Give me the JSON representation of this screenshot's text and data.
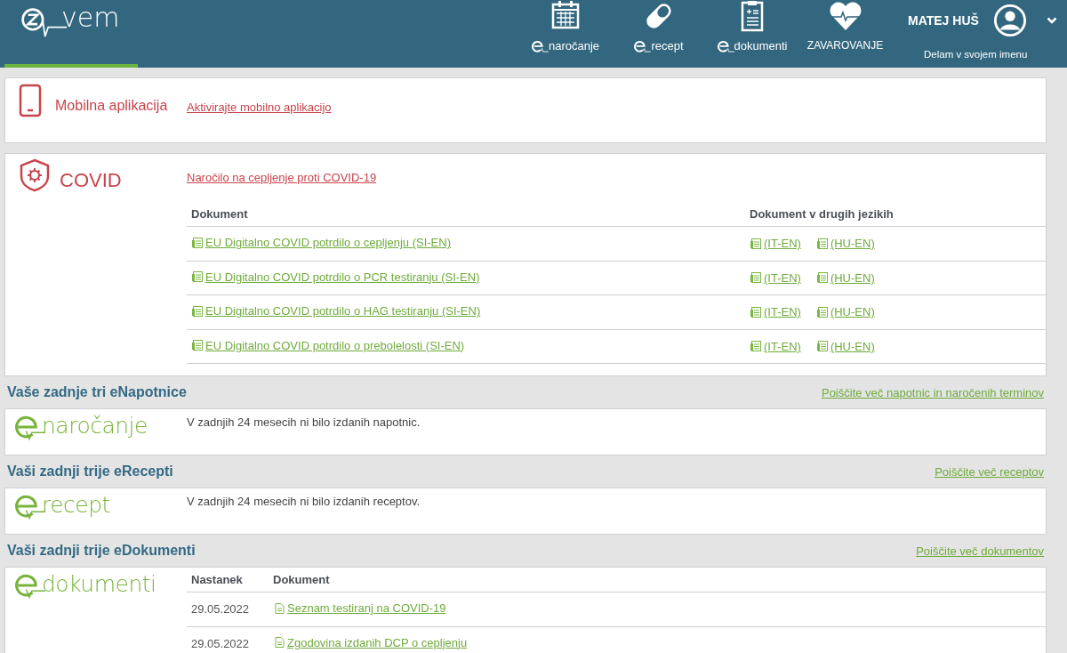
{
  "header": {
    "logo_text": "vem",
    "logo_selected": true,
    "nav": [
      {
        "label": "naročanje",
        "kind": "e-service"
      },
      {
        "label": "recept",
        "kind": "e-service"
      },
      {
        "label": "dokumenti",
        "kind": "e-service"
      },
      {
        "label": "ZAVAROVANJE",
        "kind": "plain"
      }
    ],
    "user": {
      "name": "MATEJ HUŠ",
      "subtitle": "Delam v svojem imenu"
    }
  },
  "mobile": {
    "title": "Mobilna aplikacija",
    "link": "Aktivirajte mobilno aplikacijo"
  },
  "covid": {
    "title": "COVID",
    "link": "Naročilo na cepljenje proti COVID-19",
    "columns": [
      "Dokument",
      "Dokument v drugih jezikih"
    ],
    "rows": [
      {
        "document": "EU Digitalno COVID potrdilo o cepljenju (SI-EN)",
        "other": [
          "(IT-EN)",
          "(HU-EN)"
        ]
      },
      {
        "document": "EU Digitalno COVID potrdilo o PCR testiranju (SI-EN)",
        "other": [
          "(IT-EN)",
          "(HU-EN)"
        ]
      },
      {
        "document": "EU Digitalno COVID potrdilo o HAG testiranju (SI-EN)",
        "other": [
          "(IT-EN)",
          "(HU-EN)"
        ]
      },
      {
        "document": "EU Digitalno COVID potrdilo o prebolelosti (SI-EN)",
        "other": [
          "(IT-EN)",
          "(HU-EN)"
        ]
      }
    ]
  },
  "sections": [
    {
      "title": "Vaše zadnje tri eNapotnice",
      "more_link": "Poiščite več napotnic in naročenih terminov",
      "brand": "naročanje",
      "kind": "message",
      "message": "V zadnjih 24 mesecih ni bilo izdanih napotnic."
    },
    {
      "title": "Vaši zadnji trije eRecepti",
      "more_link": "Poiščite več receptov",
      "brand": "recept",
      "kind": "message",
      "message": "V zadnjih 24 mesecih ni bilo izdanih receptov."
    },
    {
      "title": "Vaši zadnji trije eDokumenti",
      "more_link": "Poiščite več dokumentov",
      "brand": "dokumenti",
      "kind": "table",
      "columns": [
        "Nastanek",
        "Dokument"
      ],
      "rows": [
        {
          "date": "29.05.2022",
          "document": "Seznam testiranj na COVID-19"
        },
        {
          "date": "29.05.2022",
          "document": "Zgodovina izdanih DCP o cepljenju"
        }
      ]
    }
  ]
}
